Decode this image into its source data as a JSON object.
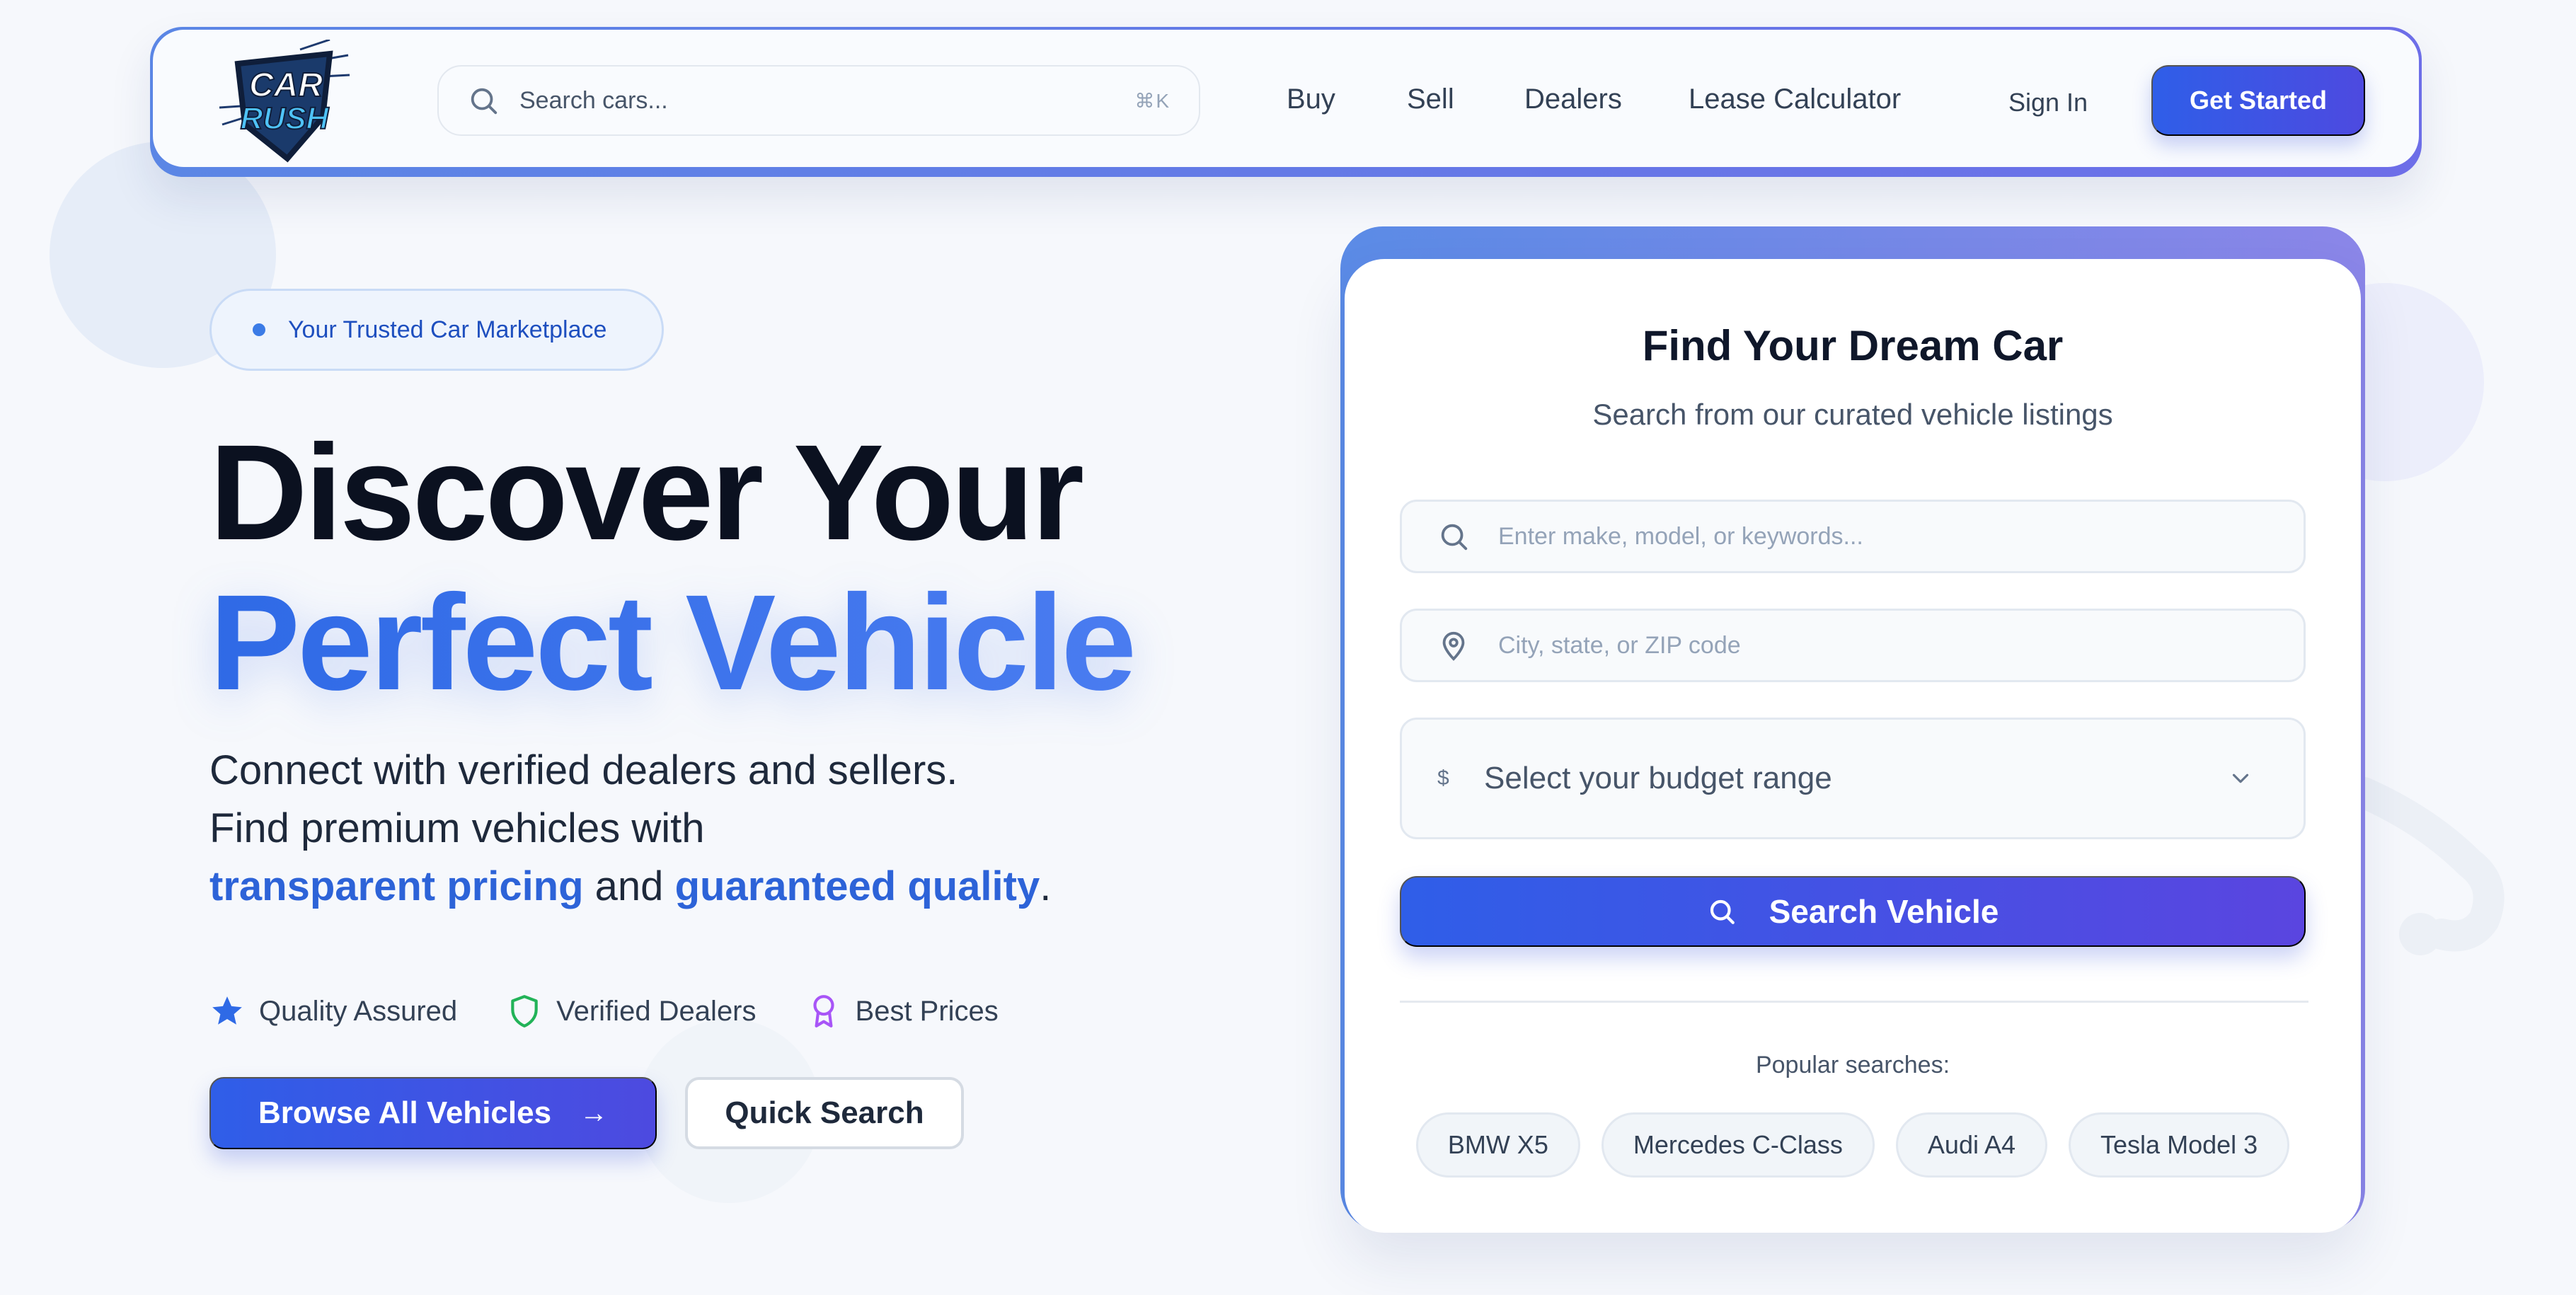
{
  "brand": {
    "logo_text_line1": "CAR",
    "logo_text_line2": "RUSH",
    "colors": {
      "primary": "#2f5ee8",
      "accent": "#4d4ae0",
      "highlight": "#2d63d8",
      "logo_bg": "#1a3a6b",
      "logo_border": "#1e2a44"
    }
  },
  "header": {
    "search": {
      "placeholder": "Search cars...",
      "shortcut": "⌘K",
      "icon": "search-icon"
    },
    "nav": [
      {
        "label": "Buy"
      },
      {
        "label": "Sell"
      },
      {
        "label": "Dealers"
      },
      {
        "label": "Lease Calculator"
      }
    ],
    "sign_in": "Sign In",
    "get_started": "Get Started"
  },
  "hero": {
    "badge": "Your Trusted Car Marketplace",
    "title_line1": "Discover Your",
    "title_line2": "Perfect Vehicle",
    "subtitle_line1": "Connect with verified dealers and sellers.",
    "subtitle_line2": "Find premium vehicles with",
    "subtitle_hl1": "transparent pricing",
    "subtitle_and": "and",
    "subtitle_hl2": "guaranteed quality",
    "subtitle_end": ".",
    "features": [
      {
        "label": "Quality Assured",
        "icon": "star-icon",
        "color": "#2f6ae6"
      },
      {
        "label": "Verified Dealers",
        "icon": "shield-icon",
        "color": "#22b358"
      },
      {
        "label": "Best Prices",
        "icon": "award-icon",
        "color": "#a855f7"
      }
    ],
    "browse_button": "Browse All Vehicles",
    "quick_search_button": "Quick Search"
  },
  "search_card": {
    "title": "Find Your Dream Car",
    "subtitle": "Search from our curated vehicle listings",
    "keyword_placeholder": "Enter make, model, or keywords...",
    "location_placeholder": "City, state, or ZIP code",
    "budget_symbol": "$",
    "budget_placeholder": "Select your budget range",
    "search_button": "Search Vehicle",
    "popular_label": "Popular searches:",
    "popular": [
      "BMW X5",
      "Mercedes C-Class",
      "Audi A4",
      "Tesla Model 3"
    ]
  }
}
